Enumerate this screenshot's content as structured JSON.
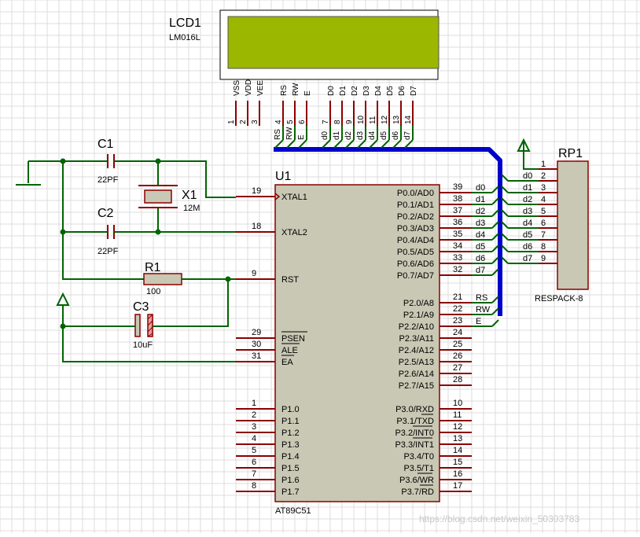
{
  "lcd": {
    "ref": "LCD1",
    "model": "LM016L",
    "pins": [
      {
        "name": "VSS",
        "num": "1"
      },
      {
        "name": "VDD",
        "num": "2"
      },
      {
        "name": "VEE",
        "num": "3"
      },
      {
        "name": "RS",
        "num": "4",
        "net": "RS"
      },
      {
        "name": "RW",
        "num": "5",
        "net": "RW"
      },
      {
        "name": "E",
        "num": "6",
        "net": "E"
      },
      {
        "name": "D0",
        "num": "7",
        "net": "d0"
      },
      {
        "name": "D1",
        "num": "8",
        "net": "d1"
      },
      {
        "name": "D2",
        "num": "9",
        "net": "d2"
      },
      {
        "name": "D3",
        "num": "10",
        "net": "d3"
      },
      {
        "name": "D4",
        "num": "11",
        "net": "d4"
      },
      {
        "name": "D5",
        "num": "12",
        "net": "d5"
      },
      {
        "name": "D6",
        "num": "13",
        "net": "d6"
      },
      {
        "name": "D7",
        "num": "14",
        "net": "d7"
      }
    ],
    "screen_color": "#9bb700"
  },
  "mcu": {
    "ref": "U1",
    "model": "AT89C51",
    "left_pins": [
      {
        "num": "19",
        "label": "XTAL1"
      },
      {
        "num": "18",
        "label": "XTAL2"
      },
      {
        "num": "9",
        "label": "RST"
      },
      {
        "num": "29",
        "label": "PSEN"
      },
      {
        "num": "30",
        "label": "ALE"
      },
      {
        "num": "31",
        "label": "EA"
      },
      {
        "num": "1",
        "label": "P1.0"
      },
      {
        "num": "2",
        "label": "P1.1"
      },
      {
        "num": "3",
        "label": "P1.2"
      },
      {
        "num": "4",
        "label": "P1.3"
      },
      {
        "num": "5",
        "label": "P1.4"
      },
      {
        "num": "6",
        "label": "P1.5"
      },
      {
        "num": "7",
        "label": "P1.6"
      },
      {
        "num": "8",
        "label": "P1.7"
      }
    ],
    "right_pins": [
      {
        "num": "39",
        "label": "P0.0/AD0",
        "net": "d0"
      },
      {
        "num": "38",
        "label": "P0.1/AD1",
        "net": "d1"
      },
      {
        "num": "37",
        "label": "P0.2/AD2",
        "net": "d2"
      },
      {
        "num": "36",
        "label": "P0.3/AD3",
        "net": "d3"
      },
      {
        "num": "35",
        "label": "P0.4/AD4",
        "net": "d4"
      },
      {
        "num": "34",
        "label": "P0.5/AD5",
        "net": "d5"
      },
      {
        "num": "33",
        "label": "P0.6/AD6",
        "net": "d6"
      },
      {
        "num": "32",
        "label": "P0.7/AD7",
        "net": "d7"
      },
      {
        "num": "21",
        "label": "P2.0/A8",
        "net": "RS"
      },
      {
        "num": "22",
        "label": "P2.1/A9",
        "net": "RW"
      },
      {
        "num": "23",
        "label": "P2.2/A10",
        "net": "E"
      },
      {
        "num": "24",
        "label": "P2.3/A11"
      },
      {
        "num": "25",
        "label": "P2.4/A12"
      },
      {
        "num": "26",
        "label": "P2.5/A13"
      },
      {
        "num": "27",
        "label": "P2.6/A14"
      },
      {
        "num": "28",
        "label": "P2.7/A15"
      },
      {
        "num": "10",
        "label": "P3.0/RXD"
      },
      {
        "num": "11",
        "label": "P3.1/TXD"
      },
      {
        "num": "12",
        "label": "P3.2/INT0"
      },
      {
        "num": "13",
        "label": "P3.3/INT1"
      },
      {
        "num": "14",
        "label": "P3.4/T0"
      },
      {
        "num": "15",
        "label": "P3.5/T1"
      },
      {
        "num": "16",
        "label": "P3.6/WR"
      },
      {
        "num": "17",
        "label": "P3.7/RD"
      }
    ]
  },
  "rpack": {
    "ref": "RP1",
    "model": "RESPACK-8",
    "pins": [
      {
        "num": "1"
      },
      {
        "num": "2",
        "net": "d0"
      },
      {
        "num": "3",
        "net": "d1"
      },
      {
        "num": "4",
        "net": "d2"
      },
      {
        "num": "5",
        "net": "d3"
      },
      {
        "num": "6",
        "net": "d4"
      },
      {
        "num": "7",
        "net": "d5"
      },
      {
        "num": "8",
        "net": "d6"
      },
      {
        "num": "9",
        "net": "d7"
      }
    ]
  },
  "components": {
    "c1": {
      "ref": "C1",
      "value": "22PF"
    },
    "c2": {
      "ref": "C2",
      "value": "22PF"
    },
    "c3": {
      "ref": "C3",
      "value": "10uF"
    },
    "r1": {
      "ref": "R1",
      "value": "100"
    },
    "x1": {
      "ref": "X1",
      "value": "12M"
    }
  },
  "watermark": "https://blog.csdn.net/weixin_50303783",
  "colors": {
    "wire": "#006400",
    "pin": "#8b0000",
    "bus": "#0000cc",
    "body": "#c8c8b4",
    "grid": "#dcdcdc"
  }
}
